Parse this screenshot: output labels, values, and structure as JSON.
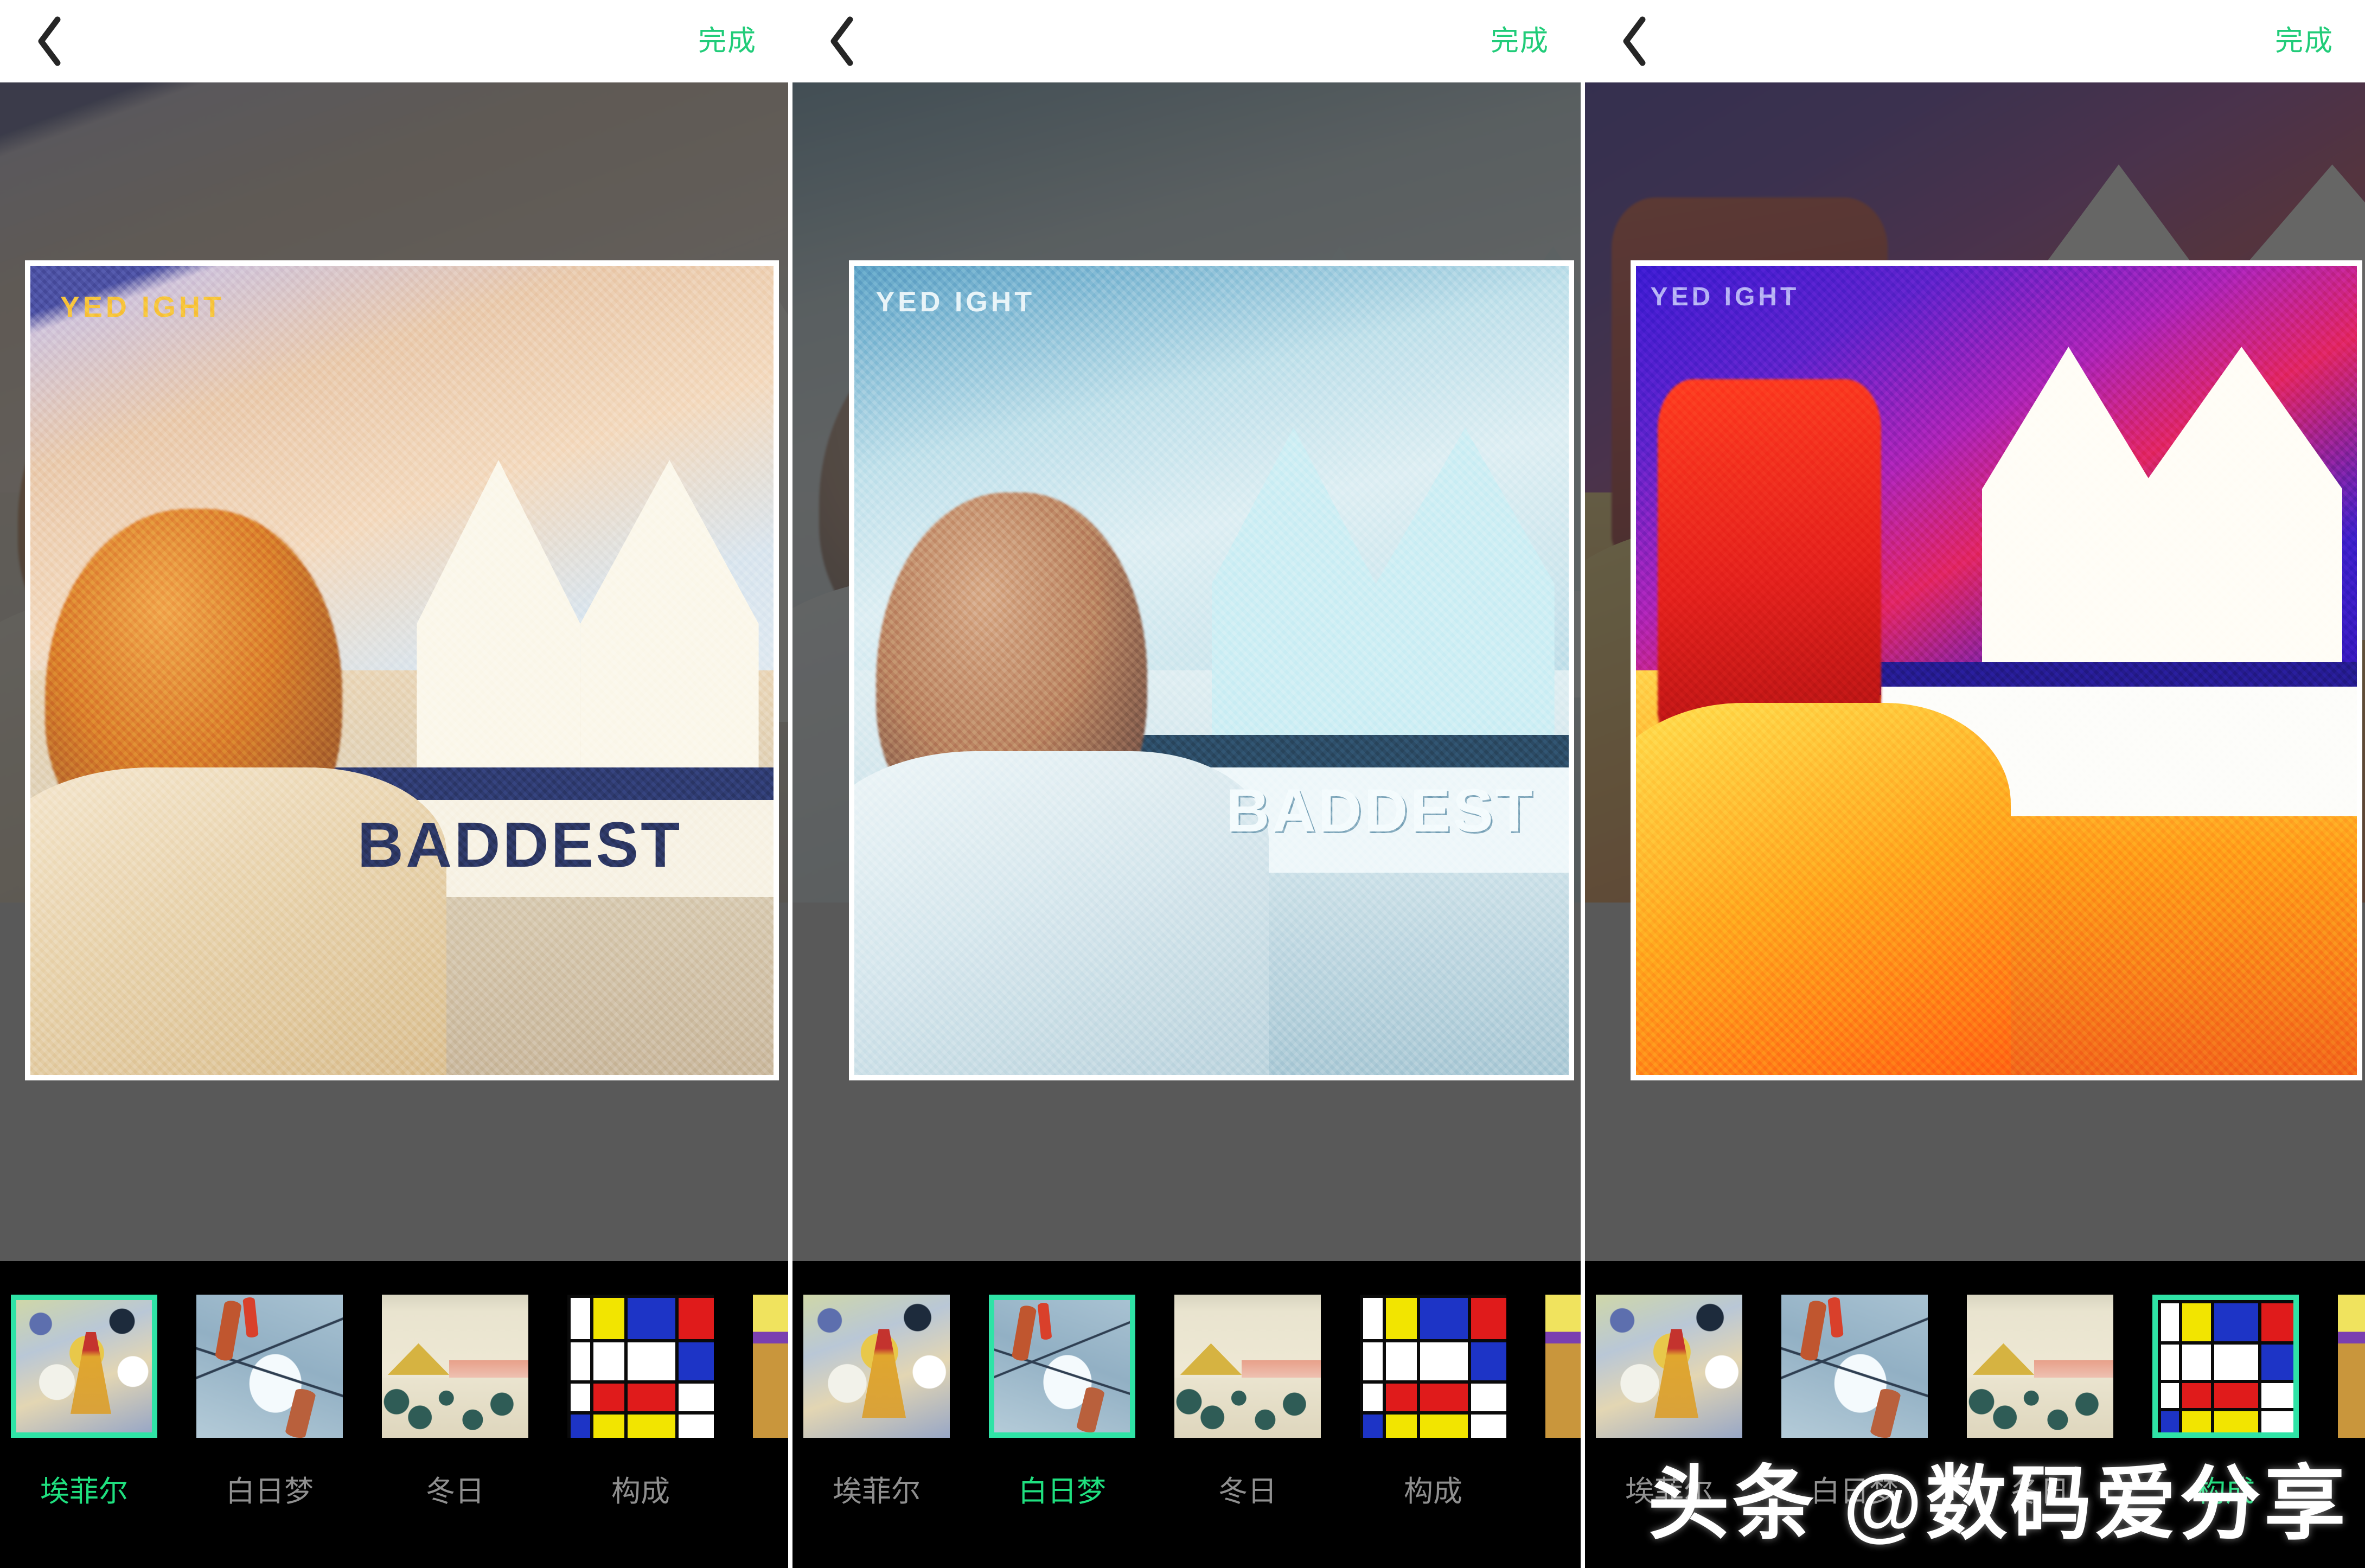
{
  "app": {
    "screen_name": "style-transfer-filter-editor",
    "panel_count": 3
  },
  "colors": {
    "accent_green": "#21cc79",
    "selection_green": "#2fe3a6",
    "selected_label_green": "#1fe07f",
    "stage_gray": "#595959",
    "filter_bar_black": "#000000",
    "topbar_white": "#ffffff",
    "label_gray": "#8f8f8f"
  },
  "topbar": {
    "back_icon": "chevron-left-icon",
    "done_label": "完成"
  },
  "photo": {
    "sign_text": "BADDEST",
    "marquee_text_p1": "YED IGHT",
    "marquee_text_p2": "YED IGHT",
    "marquee_text_p3": "YED IGHT"
  },
  "filters": [
    {
      "id": "eiffel",
      "label": "埃菲尔",
      "swatch": "tn-eiffel"
    },
    {
      "id": "daydream",
      "label": "白日梦",
      "swatch": "tn-daydream"
    },
    {
      "id": "winter",
      "label": "冬日",
      "swatch": "tn-winter"
    },
    {
      "id": "mondrian",
      "label": "构成",
      "swatch": "tn-mondrian"
    },
    {
      "id": "partial",
      "label": "",
      "swatch": "tn-partial"
    }
  ],
  "panels": [
    {
      "index": 1,
      "selected_filter_id": "eiffel",
      "selected_filter_label": "埃菲尔",
      "art_class": "a1"
    },
    {
      "index": 2,
      "selected_filter_id": "daydream",
      "selected_filter_label": "白日梦",
      "art_class": "a2"
    },
    {
      "index": 3,
      "selected_filter_id": "mondrian",
      "selected_filter_label": "构成",
      "art_class": "a3"
    }
  ],
  "mondrian_cells": [
    "#ffffff",
    "#f2e500",
    "#1d34c6",
    "#e01b1b",
    "#ffffff",
    "#ffffff",
    "#ffffff",
    "#1d34c6",
    "#ffffff",
    "#e01b1b",
    "#e01b1b",
    "#ffffff",
    "#1d34c6",
    "#f2e500",
    "#f2e500",
    "#ffffff"
  ],
  "watermark": {
    "text": "头条 @数码爱分享"
  }
}
